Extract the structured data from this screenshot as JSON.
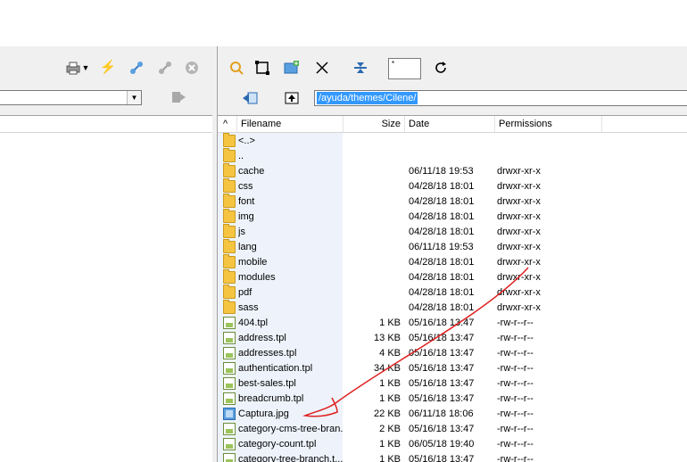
{
  "left_panel": {
    "path_value": ""
  },
  "right_panel": {
    "filter_value": "*",
    "path_value": "/ayuda/themes/Cilene/",
    "columns": [
      "Filename",
      "Size",
      "Date",
      "Permissions"
    ],
    "sort_indicator": "^",
    "files": [
      {
        "name": "<..>",
        "size": "",
        "date": "",
        "perms": "",
        "type": "folder"
      },
      {
        "name": "..",
        "size": "",
        "date": "",
        "perms": "",
        "type": "folder"
      },
      {
        "name": "cache",
        "size": "",
        "date": "06/11/18  19:53",
        "perms": "drwxr-xr-x",
        "type": "folder"
      },
      {
        "name": "css",
        "size": "",
        "date": "04/28/18  18:01",
        "perms": "drwxr-xr-x",
        "type": "folder"
      },
      {
        "name": "font",
        "size": "",
        "date": "04/28/18  18:01",
        "perms": "drwxr-xr-x",
        "type": "folder"
      },
      {
        "name": "img",
        "size": "",
        "date": "04/28/18  18:01",
        "perms": "drwxr-xr-x",
        "type": "folder"
      },
      {
        "name": "js",
        "size": "",
        "date": "04/28/18  18:01",
        "perms": "drwxr-xr-x",
        "type": "folder"
      },
      {
        "name": "lang",
        "size": "",
        "date": "06/11/18  19:53",
        "perms": "drwxr-xr-x",
        "type": "folder"
      },
      {
        "name": "mobile",
        "size": "",
        "date": "04/28/18  18:01",
        "perms": "drwxr-xr-x",
        "type": "folder"
      },
      {
        "name": "modules",
        "size": "",
        "date": "04/28/18  18:01",
        "perms": "drwxr-xr-x",
        "type": "folder"
      },
      {
        "name": "pdf",
        "size": "",
        "date": "04/28/18  18:01",
        "perms": "drwxr-xr-x",
        "type": "folder"
      },
      {
        "name": "sass",
        "size": "",
        "date": "04/28/18  18:01",
        "perms": "drwxr-xr-x",
        "type": "folder"
      },
      {
        "name": "404.tpl",
        "size": "1 KB",
        "date": "05/16/18  13:47",
        "perms": "-rw-r--r--",
        "type": "file"
      },
      {
        "name": "address.tpl",
        "size": "13 KB",
        "date": "05/16/18  13:47",
        "perms": "-rw-r--r--",
        "type": "file"
      },
      {
        "name": "addresses.tpl",
        "size": "4 KB",
        "date": "05/16/18  13:47",
        "perms": "-rw-r--r--",
        "type": "file"
      },
      {
        "name": "authentication.tpl",
        "size": "34 KB",
        "date": "05/16/18  13:47",
        "perms": "-rw-r--r--",
        "type": "file"
      },
      {
        "name": "best-sales.tpl",
        "size": "1 KB",
        "date": "05/16/18  13:47",
        "perms": "-rw-r--r--",
        "type": "file"
      },
      {
        "name": "breadcrumb.tpl",
        "size": "1 KB",
        "date": "05/16/18  13:47",
        "perms": "-rw-r--r--",
        "type": "file"
      },
      {
        "name": "Captura.jpg",
        "size": "22 KB",
        "date": "06/11/18  18:06",
        "perms": "-rw-r--r--",
        "type": "image"
      },
      {
        "name": "category-cms-tree-bran...",
        "size": "2 KB",
        "date": "05/16/18  13:47",
        "perms": "-rw-r--r--",
        "type": "file"
      },
      {
        "name": "category-count.tpl",
        "size": "1 KB",
        "date": "06/05/18  19:40",
        "perms": "-rw-r--r--",
        "type": "file"
      },
      {
        "name": "category-tree-branch.t...",
        "size": "1 KB",
        "date": "05/16/18  13:47",
        "perms": "-rw-r--r--",
        "type": "file"
      }
    ]
  },
  "colors": {
    "selection": "#3399ff",
    "annotation": "#e02020",
    "toolbar_accent": "#f0b400"
  }
}
